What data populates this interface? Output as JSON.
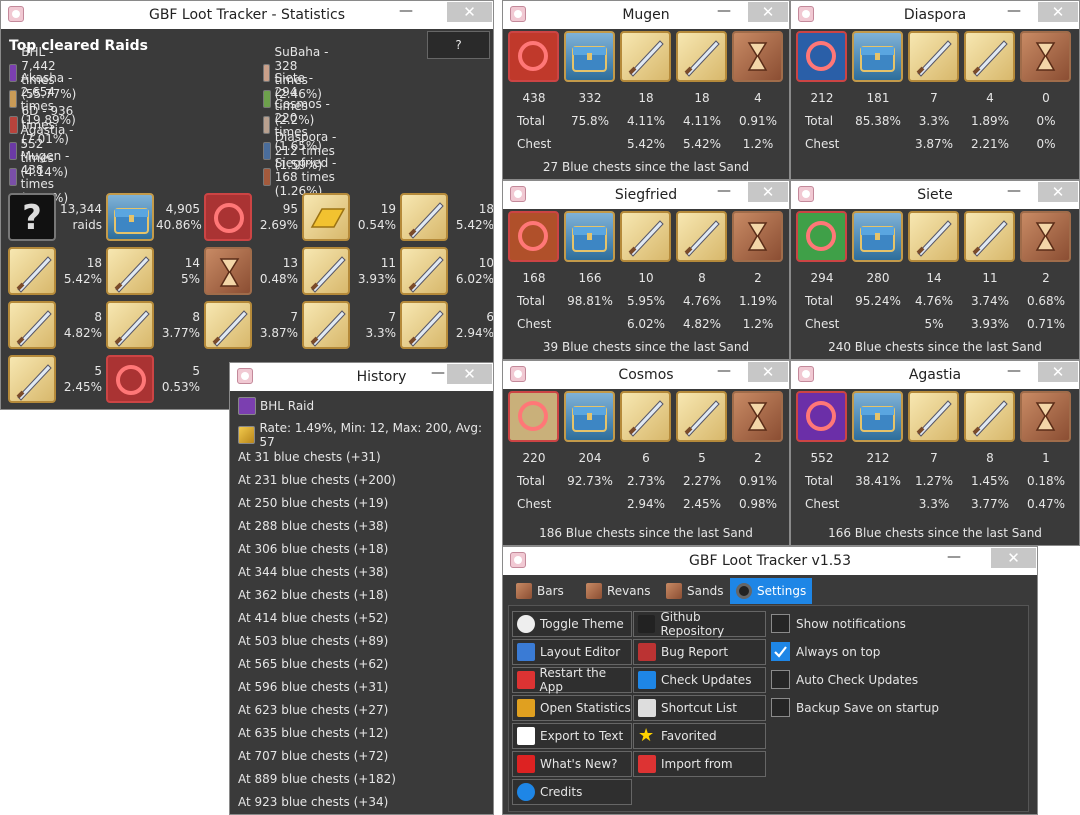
{
  "stats": {
    "title": "GBF Loot Tracker - Statistics",
    "heading": "Top cleared Raids",
    "help_btn": "?",
    "raids_left": [
      {
        "label": "BHL - 7,442 times (55.77%)",
        "color": "#7b3fb0"
      },
      {
        "label": "Akasha - 2,654 times (19.89%)",
        "color": "#c99b57"
      },
      {
        "label": "6D - 936 times (7.01%)",
        "color": "#b8433c"
      },
      {
        "label": "Agastia - 552 times (4.14%)",
        "color": "#6b3aa5"
      },
      {
        "label": "Mugen - 438 times (3.28%)",
        "color": "#7a4fa8"
      }
    ],
    "raids_right": [
      {
        "label": "SuBaha - 328 times (2.46%)",
        "color": "#c9a08a"
      },
      {
        "label": "Siete - 294 times (2.2%)",
        "color": "#6da04c"
      },
      {
        "label": "Cosmos - 220 times (1.65%)",
        "color": "#b8a08f"
      },
      {
        "label": "Diaspora - 212 times (1.59%)",
        "color": "#4a6d9b"
      },
      {
        "label": "Siegfried - 168 times (1.26%)",
        "color": "#a35a3c"
      }
    ],
    "items": [
      {
        "kind": "q",
        "value": "13,344\nraids"
      },
      {
        "kind": "chest",
        "value": "4,905\n40.86%"
      },
      {
        "kind": "boss",
        "value": "95\n2.69%"
      },
      {
        "kind": "gold",
        "value": "19\n0.54%"
      },
      {
        "kind": "weapon",
        "value": "18\n5.42%"
      },
      {
        "kind": "weapon",
        "value": "18\n5.42%"
      },
      {
        "kind": "weapon",
        "value": "14\n5%"
      },
      {
        "kind": "sand",
        "value": "13\n0.48%"
      },
      {
        "kind": "weapon",
        "value": "11\n3.93%"
      },
      {
        "kind": "weapon",
        "value": "10\n6.02%"
      },
      {
        "kind": "weapon",
        "value": "8\n4.82%"
      },
      {
        "kind": "weapon",
        "value": "8\n3.77%"
      },
      {
        "kind": "weapon",
        "value": "7\n3.87%"
      },
      {
        "kind": "weapon",
        "value": "7\n3.3%"
      },
      {
        "kind": "weapon",
        "value": "6\n2.94%"
      },
      {
        "kind": "weapon",
        "value": "5\n2.45%"
      },
      {
        "kind": "boss",
        "value": "5\n0.53%"
      }
    ]
  },
  "panels": [
    {
      "id": "mugen",
      "title": "Mugen",
      "counts": [
        "438",
        "332",
        "18",
        "18",
        "4"
      ],
      "total": [
        "75.8%",
        "4.11%",
        "4.11%",
        "0.91%"
      ],
      "chest": [
        "5.42%",
        "5.42%",
        "1.2%"
      ],
      "footer": "27 Blue chests since the last Sand",
      "boss_color": "#c0392b"
    },
    {
      "id": "diaspora",
      "title": "Diaspora",
      "counts": [
        "212",
        "181",
        "7",
        "4",
        "0"
      ],
      "total": [
        "85.38%",
        "3.3%",
        "1.89%",
        "0%"
      ],
      "chest": [
        "3.87%",
        "2.21%",
        "0%"
      ],
      "footer": "",
      "boss_color": "#2a5fa8"
    },
    {
      "id": "siegfried",
      "title": "Siegfried",
      "counts": [
        "168",
        "166",
        "10",
        "8",
        "2"
      ],
      "total": [
        "98.81%",
        "5.95%",
        "4.76%",
        "1.19%"
      ],
      "chest": [
        "6.02%",
        "4.82%",
        "1.2%"
      ],
      "footer": "39 Blue chests since the last Sand",
      "boss_color": "#b0502a"
    },
    {
      "id": "siete",
      "title": "Siete",
      "counts": [
        "294",
        "280",
        "14",
        "11",
        "2"
      ],
      "total": [
        "95.24%",
        "4.76%",
        "3.74%",
        "0.68%"
      ],
      "chest": [
        "5%",
        "3.93%",
        "0.71%"
      ],
      "footer": "240 Blue chests since the last Sand",
      "boss_color": "#3fa048"
    },
    {
      "id": "cosmos",
      "title": "Cosmos",
      "counts": [
        "220",
        "204",
        "6",
        "5",
        "2"
      ],
      "total": [
        "92.73%",
        "2.73%",
        "2.27%",
        "0.91%"
      ],
      "chest": [
        "2.94%",
        "2.45%",
        "0.98%"
      ],
      "footer": "186 Blue chests since the last Sand",
      "boss_color": "#c9b07a"
    },
    {
      "id": "agastia",
      "title": "Agastia",
      "counts": [
        "552",
        "212",
        "7",
        "8",
        "1"
      ],
      "total": [
        "38.41%",
        "1.27%",
        "1.45%",
        "0.18%"
      ],
      "chest": [
        "3.3%",
        "3.77%",
        "0.47%"
      ],
      "footer": "166 Blue chests since the last Sand",
      "boss_color": "#6b2fa8"
    }
  ],
  "panel_labels": {
    "total": "Total",
    "chest": "Chest"
  },
  "history": {
    "title": "History",
    "raid": "BHL Raid",
    "rate": "Rate: 1.49%, Min: 12, Max: 200, Avg: 57",
    "rows": [
      "At 31 blue chests (+31)",
      "At 231 blue chests (+200)",
      "At 250 blue chests (+19)",
      "At 288 blue chests (+38)",
      "At 306 blue chests (+18)",
      "At 344 blue chests (+38)",
      "At 362 blue chests (+18)",
      "At 414 blue chests (+52)",
      "At 503 blue chests (+89)",
      "At 565 blue chests (+62)",
      "At 596 blue chests (+31)",
      "At 623 blue chests (+27)",
      "At 635 blue chests (+12)",
      "At 707 blue chests (+72)",
      "At 889 blue chests (+182)",
      "At 923 blue chests (+34)"
    ]
  },
  "settings": {
    "title": "GBF Loot Tracker v1.53",
    "tabs": [
      "Bars",
      "Revans",
      "Sands",
      "Settings"
    ],
    "active_tab": "Settings",
    "buttons_left": [
      {
        "label": "Toggle Theme",
        "icon": "theme-icon"
      },
      {
        "label": "Layout Editor",
        "icon": "layout-icon"
      },
      {
        "label": "Restart the App",
        "icon": "restart-icon"
      },
      {
        "label": "Open Statistics",
        "icon": "statistics-icon"
      },
      {
        "label": "Export to Text",
        "icon": "export-icon"
      },
      {
        "label": "What's New?",
        "icon": "whats-new-icon"
      },
      {
        "label": "Credits",
        "icon": "credits-icon"
      }
    ],
    "buttons_right": [
      {
        "label": "Github Repository",
        "icon": "github-icon"
      },
      {
        "label": "Bug Report",
        "icon": "bug-icon"
      },
      {
        "label": "Check Updates",
        "icon": "update-icon"
      },
      {
        "label": "Shortcut List",
        "icon": "shortcut-icon"
      },
      {
        "label": "Favorited",
        "icon": "star-icon"
      },
      {
        "label": "Import from",
        "icon": "import-icon"
      }
    ],
    "checkboxes": [
      {
        "label": "Show notifications",
        "checked": false
      },
      {
        "label": "Always on top",
        "checked": true
      },
      {
        "label": "Auto Check Updates",
        "checked": false
      },
      {
        "label": "Backup Save on startup",
        "checked": false
      }
    ]
  }
}
